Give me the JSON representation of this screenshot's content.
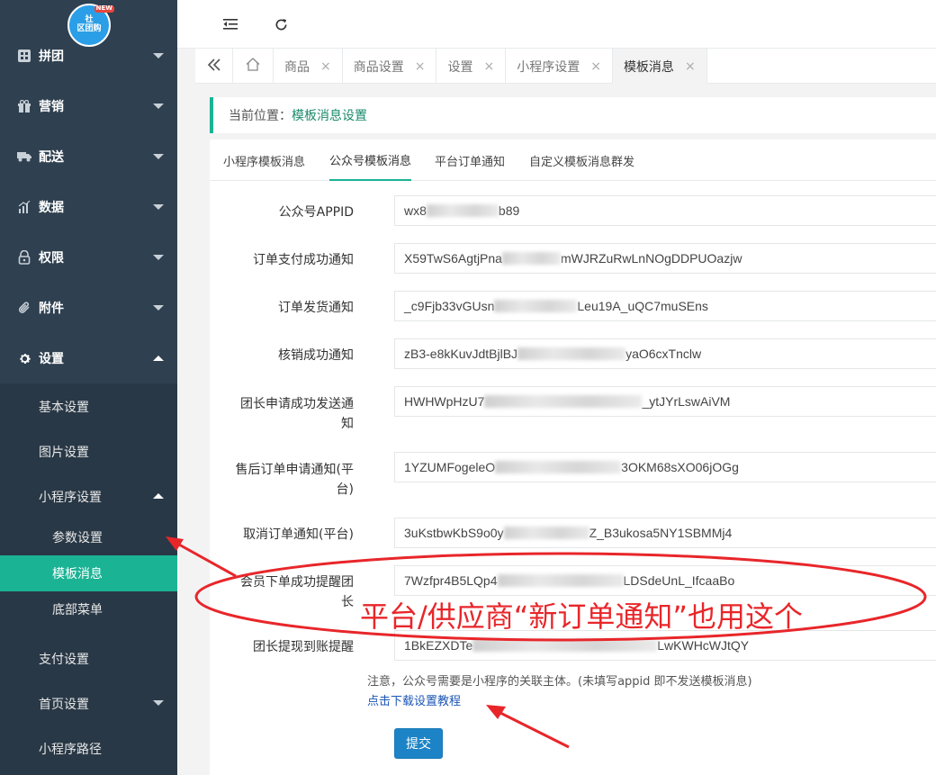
{
  "logo": {
    "text_top": "社",
    "text_bottom": "区团购",
    "badge": "NEW"
  },
  "sidebar": {
    "items": [
      {
        "label": "拼团",
        "icon": "grid-icon"
      },
      {
        "label": "营销",
        "icon": "gift-icon"
      },
      {
        "label": "配送",
        "icon": "truck-icon"
      },
      {
        "label": "数据",
        "icon": "bar-chart-icon"
      },
      {
        "label": "权限",
        "icon": "lock-icon"
      },
      {
        "label": "附件",
        "icon": "paperclip-icon"
      },
      {
        "label": "设置",
        "icon": "gear-icon"
      }
    ],
    "sub_items": {
      "basic": "基本设置",
      "image": "图片设置",
      "miniapp": "小程序设置",
      "params": "参数设置",
      "template": "模板消息",
      "bottom_menu": "底部菜单",
      "payment": "支付设置",
      "home": "首页设置",
      "path": "小程序路径"
    }
  },
  "topbar": {
    "collapse_icon": "indent-icon",
    "refresh_icon": "refresh-icon"
  },
  "tabs": {
    "back_icon": "double-chevron-left-icon",
    "home_icon": "home-icon",
    "items": [
      {
        "label": "商品",
        "close": "×"
      },
      {
        "label": "商品设置",
        "close": "×"
      },
      {
        "label": "设置",
        "close": "×"
      },
      {
        "label": "小程序设置",
        "close": "×"
      },
      {
        "label": "模板消息",
        "close": "×"
      }
    ]
  },
  "breadcrumb": {
    "prefix": "当前位置：",
    "current": "模板消息设置"
  },
  "subtabs": [
    "小程序模板消息",
    "公众号模板消息",
    "平台订单通知",
    "自定义模板消息群发"
  ],
  "form": {
    "fields": [
      {
        "label": "公众号APPID",
        "pre": "wx8",
        "post": "b89"
      },
      {
        "label": "订单支付成功通知",
        "pre": "X59TwS6AgtjPna",
        "post": "mWJRZuRwLnNOgDDPUOazjw"
      },
      {
        "label": "订单发货通知",
        "pre": "_c9Fjb33vGUsn",
        "post": "Leu19A_uQC7muSEns"
      },
      {
        "label": "核销成功通知",
        "pre": "zB3-e8kKuvJdtBjlBJ",
        "post": "yaO6cxTnclw"
      },
      {
        "label1": "团长申请成功发送通",
        "label2": "知",
        "pre": "HWHWpHzU7",
        "post": "_ytJYrLswAiVM"
      },
      {
        "label1": "售后订单申请通知(平",
        "label2": "台)",
        "pre": "1YZUMFogeleO",
        "post": "3OKM68sXO06jOGg"
      },
      {
        "label": "取消订单通知(平台)",
        "pre": "3uKstbwKbS9o0y",
        "post": "Z_B3ukosa5NY1SBMMj4"
      },
      {
        "label1": "会员下单成功提醒团",
        "label2": "长",
        "pre": "7Wzfpr4B5LQp4",
        "post": "LDSdeUnL_IfcaaBo"
      },
      {
        "label": "团长提现到账提醒",
        "pre": "1BkEZXDTe",
        "post": "LwKWHcWJtQY"
      }
    ],
    "note": "注意，公众号需要是小程序的关联主体。(未填写appid 即不发送模板消息)",
    "link": "点击下载设置教程",
    "submit": "提交"
  },
  "annotation": {
    "text": "平台/供应商“新订单通知”也用这个",
    "color": "#e8262a"
  }
}
